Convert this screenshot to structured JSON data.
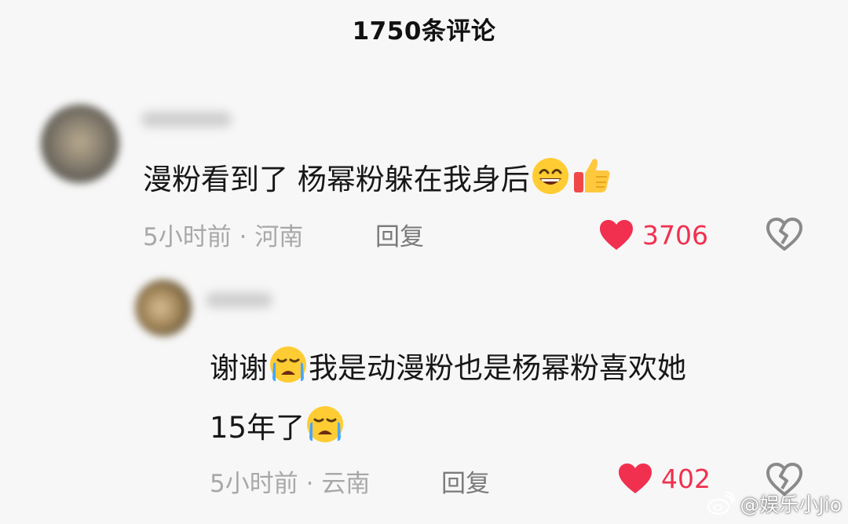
{
  "header": {
    "title": "1750条评论"
  },
  "comments": [
    {
      "text_before": "漫粉看到了 杨幂粉躲在我身后",
      "emojis": [
        "grin-emoji",
        "thumbs-up-emoji"
      ],
      "time": "5小时前",
      "separator": "·",
      "location": "河南",
      "reply_label": "回复",
      "likes": "3706"
    },
    {
      "line1_a": "谢谢",
      "line1_b": "我是动漫粉也是杨幂粉喜欢她",
      "line2": "15年了",
      "emojis": [
        "crying-emoji"
      ],
      "time": "5小时前",
      "separator": "·",
      "location": "云南",
      "reply_label": "回复",
      "likes": "402"
    }
  ],
  "colors": {
    "like": "#f1304f",
    "meta": "#a8a8a8",
    "reply": "#7a7a7a"
  },
  "watermark": {
    "text": "@娱乐小Jio"
  }
}
